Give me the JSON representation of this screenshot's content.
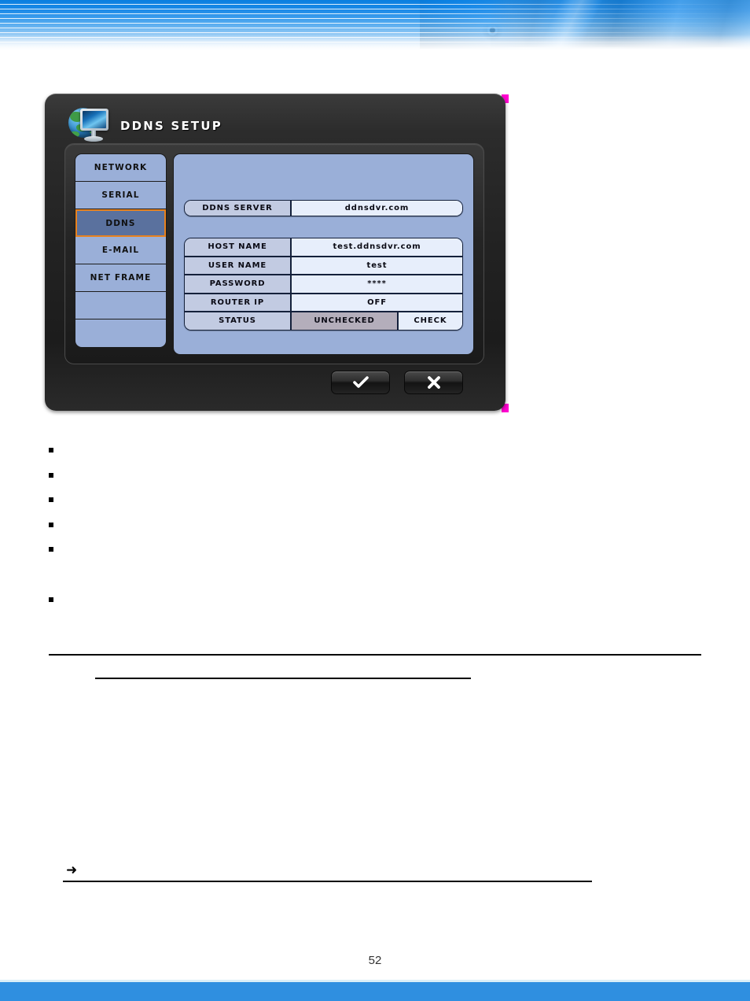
{
  "page": {
    "number": "52",
    "banner_colors": {
      "blue_start": "#0a7fe0",
      "blue_mid": "#4aa5ee",
      "white": "#ffffff"
    },
    "footer_color": "#2f8fe0"
  },
  "dialog": {
    "title": "DDNS SETUP",
    "icon": "globe-monitor-icon",
    "corner_marker_color": "#ff00d0",
    "accent_selected_border": "#e8821e",
    "panel_color": "#9aafd8",
    "sidebar": {
      "items": [
        {
          "label": "NETWORK",
          "selected": false
        },
        {
          "label": "SERIAL",
          "selected": false
        },
        {
          "label": "DDNS",
          "selected": true
        },
        {
          "label": "E-MAIL",
          "selected": false
        },
        {
          "label": "NET FRAME",
          "selected": false
        },
        {
          "label": "",
          "selected": false
        },
        {
          "label": "",
          "selected": false
        }
      ]
    },
    "server_row": {
      "label": "DDNS SERVER",
      "value": "ddnsdvr.com"
    },
    "settings_rows": [
      {
        "label": "HOST NAME",
        "value": "test.ddnsdvr.com"
      },
      {
        "label": "USER NAME",
        "value": "test"
      },
      {
        "label": "PASSWORD",
        "value": "****"
      },
      {
        "label": "ROUTER IP",
        "value": "OFF"
      }
    ],
    "status_row": {
      "label": "STATUS",
      "value": "UNCHECKED",
      "action": "CHECK",
      "value_bg": "#b4aebb"
    },
    "buttons": {
      "confirm": "confirm-check-button",
      "cancel": "cancel-close-button"
    }
  }
}
